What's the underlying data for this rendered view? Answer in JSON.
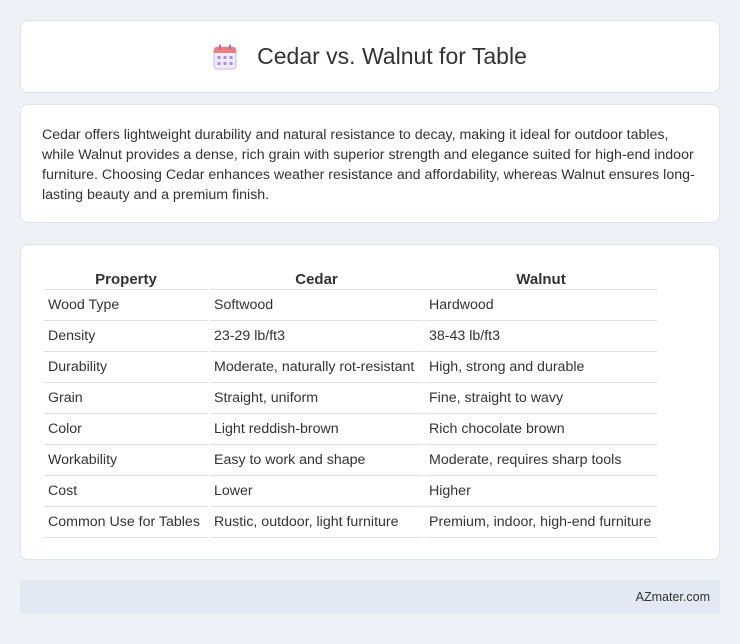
{
  "header": {
    "title": "Cedar vs. Walnut for Table",
    "icon": "calendar-icon"
  },
  "description": "Cedar offers lightweight durability and natural resistance to decay, making it ideal for outdoor tables, while Walnut provides a dense, rich grain with superior strength and elegance suited for high-end indoor furniture. Choosing Cedar enhances weather resistance and affordability, whereas Walnut ensures long-lasting beauty and a premium finish.",
  "table": {
    "headers": [
      "Property",
      "Cedar",
      "Walnut"
    ],
    "rows": [
      [
        "Wood Type",
        "Softwood",
        "Hardwood"
      ],
      [
        "Density",
        "23-29 lb/ft3",
        "38-43 lb/ft3"
      ],
      [
        "Durability",
        "Moderate, naturally rot-resistant",
        "High, strong and durable"
      ],
      [
        "Grain",
        "Straight, uniform",
        "Fine, straight to wavy"
      ],
      [
        "Color",
        "Light reddish-brown",
        "Rich chocolate brown"
      ],
      [
        "Workability",
        "Easy to work and shape",
        "Moderate, requires sharp tools"
      ],
      [
        "Cost",
        "Lower",
        "Higher"
      ],
      [
        "Common Use for Tables",
        "Rustic, outdoor, light furniture",
        "Premium, indoor, high-end furniture"
      ]
    ]
  },
  "footer": {
    "brand": "AZmater.com"
  },
  "colors": {
    "background": "#eef1f6",
    "card": "#ffffff",
    "footer_bar": "#e3e9f3",
    "icon_accent": "#a98ee0"
  }
}
